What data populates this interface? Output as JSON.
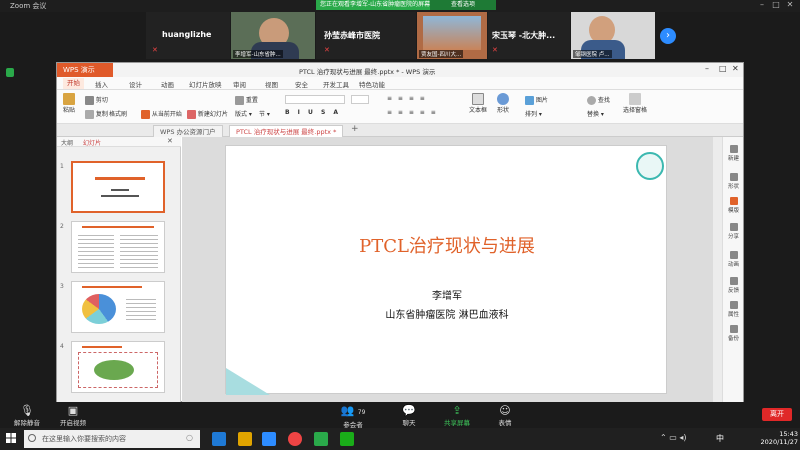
{
  "zoom": {
    "app_title": "Zoom 会议",
    "banner_text": "您正在观看李增军-山东省肿瘤医院的屏幕",
    "view_options": "查看选项",
    "participants": [
      {
        "name": "huanglizhe",
        "caption": ""
      },
      {
        "name": "",
        "caption": "李增军-山东省肿..."
      },
      {
        "name": "孙莹赤峰市医院",
        "caption": ""
      },
      {
        "name": "",
        "caption": "贾友国-四川大..."
      },
      {
        "name": "宋玉琴 -北大肿...",
        "caption": ""
      },
      {
        "name": "",
        "caption": "邹钢医院 卢..."
      }
    ],
    "toolbar": {
      "mute": "解除静音",
      "video": "开启视频",
      "participants": "参会者",
      "participants_count": "79",
      "chat": "聊天",
      "share": "共享屏幕",
      "reactions": "表情",
      "leave": "离开"
    }
  },
  "wps": {
    "app_name": "WPS 演示",
    "window_title": "PTCL 治疗现状与进展 最终.pptx * - WPS 演示",
    "ribbon_tabs": [
      "开始",
      "插入",
      "设计",
      "动画",
      "幻灯片放映",
      "审阅",
      "视图",
      "安全",
      "开发工具",
      "特色功能"
    ],
    "ribbon_items": {
      "paste": "粘贴",
      "cut": "剪切",
      "copy": "复制",
      "format_painter": "格式刷",
      "from_current": "从当前开始",
      "new_slide": "新建幻灯片",
      "layout": "版式",
      "reset": "重置",
      "section": "节",
      "textbox": "文本框",
      "shape": "形状",
      "arrange": "排列",
      "picture": "图片",
      "find": "查找",
      "replace": "替换",
      "select_pane": "选择窗格"
    },
    "doc_tabs": [
      "WPS 办公资源门户",
      "PTCL 治疗现状与进展 最终.pptx *"
    ],
    "pane_tabs": [
      "大纲",
      "幻灯片"
    ],
    "slide": {
      "title": "PTCL治疗现状与进展",
      "author": "李增军",
      "institution": "山东省肿瘤医院 淋巴血液科"
    },
    "thumb_numbers": [
      "1",
      "2",
      "3",
      "4"
    ],
    "right_rail": [
      "新建",
      "形状",
      "模版",
      "分享",
      "动画",
      "反馈",
      "属性",
      "备份"
    ]
  },
  "taskbar": {
    "search_placeholder": "在这里输入你要搜索的内容",
    "time": "15:43",
    "date": "2020/11/27",
    "ime": "中"
  },
  "colors": {
    "accent_orange": "#e0622a",
    "zoom_green": "#2aa94a",
    "zoom_leave": "#e02828",
    "zoom_blue": "#2d8cff"
  }
}
